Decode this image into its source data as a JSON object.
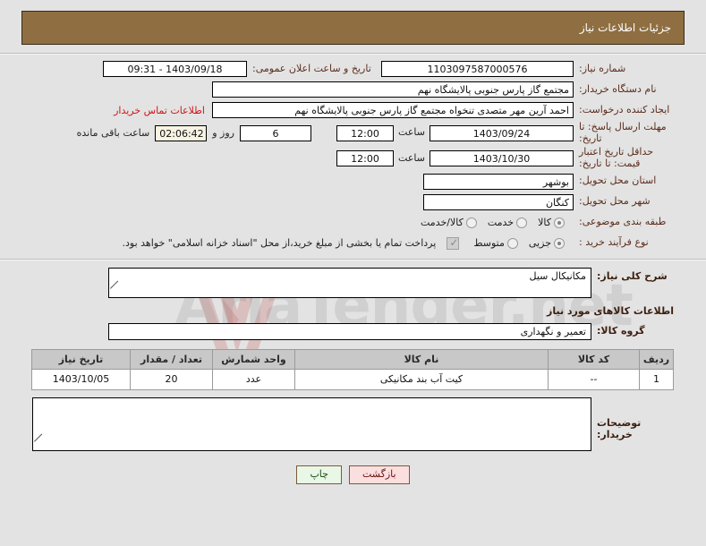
{
  "header": {
    "title": "جزئیات اطلاعات نیاز"
  },
  "fields": {
    "need_no_label": "شماره نیاز:",
    "need_no_value": "1103097587000576",
    "public_announce_label": "تاریخ و ساعت اعلان عمومی:",
    "public_announce_value": "09:31 - 1403/09/18",
    "buyer_org_label": "نام دستگاه خریدار:",
    "buyer_org_value": "مجتمع گاز پارس جنوبی  پالایشگاه نهم",
    "requester_label": "ایجاد کننده درخواست:",
    "requester_value": "احمد آرین مهر متصدی تنخواه مجتمع گاز پارس جنوبی  پالایشگاه نهم",
    "contact_link": "اطلاعات تماس خریدار",
    "response_deadline_label": "مهلت ارسال پاسخ: تا تاریخ:",
    "response_deadline_date": "1403/09/24",
    "hour_label": "ساعت",
    "response_deadline_time": "12:00",
    "days_remaining_value": "6",
    "days_word": "روز و",
    "time_remaining_value": "02:06:42",
    "remaining_suffix": "ساعت باقی مانده",
    "price_validity_label": "حداقل تاریخ اعتبار قیمت: تا تاریخ:",
    "price_validity_date": "1403/10/30",
    "price_validity_time": "12:00",
    "province_label": "استان محل تحویل:",
    "province_value": "بوشهر",
    "city_label": "شهر محل تحویل:",
    "city_value": "کنگان",
    "category_label": "طبقه بندی موضوعی:",
    "category_options": [
      {
        "label": "کالا",
        "selected": true
      },
      {
        "label": "خدمت",
        "selected": false
      },
      {
        "label": "کالا/خدمت",
        "selected": false
      }
    ],
    "process_label": "نوع فرآیند خرید :",
    "process_options": [
      {
        "label": "جزیی",
        "selected": true
      },
      {
        "label": "متوسط",
        "selected": false
      }
    ],
    "treasury_checkbox_checked": true,
    "treasury_note": "پرداخت تمام یا بخشی از مبلغ خرید،از محل \"اسناد خزانه اسلامی\" خواهد بود."
  },
  "description": {
    "summary_label": "شرح کلی نیاز:",
    "summary_value": "مکانیکال سیل",
    "goods_section_title": "اطلاعات کالاهای مورد نیاز",
    "group_label": "گروه کالا:",
    "group_value": "تعمیر و نگهداری"
  },
  "goods_table": {
    "columns": [
      "ردیف",
      "کد کالا",
      "نام کالا",
      "واحد شمارش",
      "تعداد / مقدار",
      "تاریخ نیاز"
    ],
    "rows": [
      [
        "1",
        "--",
        "کیت آب بند مکانیکی",
        "عدد",
        "20",
        "1403/10/05"
      ]
    ]
  },
  "notes": {
    "label": "توضیحات خریدار:",
    "value": ""
  },
  "buttons": {
    "print": "چاپ",
    "back": "بازگشت"
  },
  "watermark": {
    "text": "AriaTender.net"
  },
  "colors": {
    "header_bg": "#8f6f42",
    "label": "#5c2e1e",
    "link": "#d01616",
    "page_bg": "#e3e3e3",
    "table_header": "#c8c8c8"
  }
}
